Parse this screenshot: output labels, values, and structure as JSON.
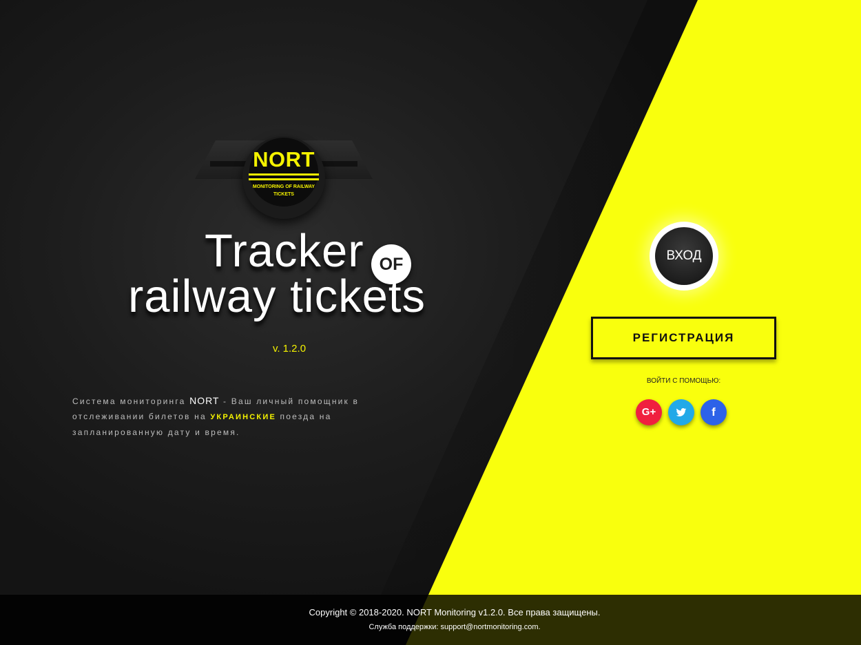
{
  "logo": {
    "word": "NORT",
    "subtitle": "MONITORING OF RAILWAY TICKETS"
  },
  "hero": {
    "title_line1": "Tracker",
    "title_badge": "OF",
    "title_line2": "railway tickets",
    "version": "v. 1.2.0"
  },
  "description": {
    "part1": "Система мониторинга ",
    "brand": "NORT",
    "part2": " - Ваш личный помощник в отслеживании билетов на ",
    "highlight": "УКРАИНСКИЕ",
    "part3": " поезда на запланированную дату и время."
  },
  "auth": {
    "login_label": "ВХОД",
    "register_label": "РЕГИСТРАЦИЯ",
    "social_label": "ВОЙТИ С ПОМОЩЬЮ:",
    "social": [
      {
        "name": "google-plus",
        "glyph": "G+",
        "color": "#f0203f"
      },
      {
        "name": "twitter",
        "glyph": "🐦",
        "color": "#22a9e8"
      },
      {
        "name": "facebook",
        "glyph": "f",
        "color": "#2d62e8"
      }
    ]
  },
  "footer": {
    "copyright": "Copyright © 2018-2020. NORT Monitoring v1.2.0. Все права защищены.",
    "support": "Служба поддержки: support@nortmonitoring.com."
  },
  "colors": {
    "accent_yellow": "#f9ff0d",
    "dark_bg": "#1d1d1d"
  }
}
